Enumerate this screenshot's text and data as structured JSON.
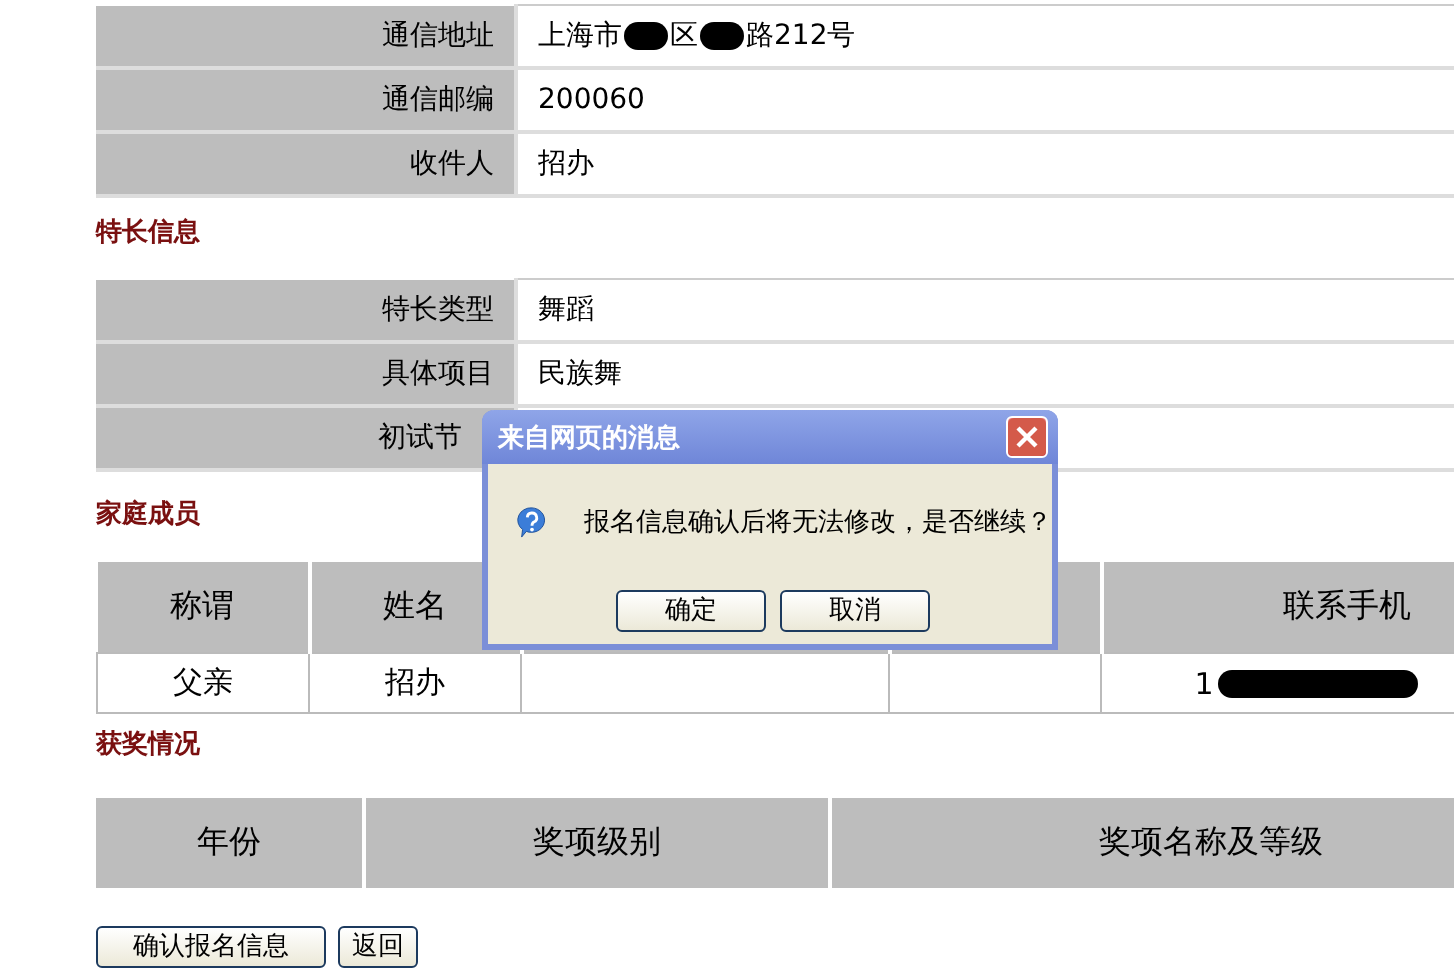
{
  "contact": {
    "rows": [
      {
        "label": "通信地址",
        "parts": [
          {
            "kind": "text",
            "text": "上海市"
          },
          {
            "kind": "redacted"
          },
          {
            "kind": "text",
            "text": "区"
          },
          {
            "kind": "redacted"
          },
          {
            "kind": "text",
            "text": "路212号"
          }
        ]
      },
      {
        "label": "通信邮编",
        "parts": [
          {
            "kind": "text",
            "text": "200060"
          }
        ]
      },
      {
        "label": "收件人",
        "parts": [
          {
            "kind": "text",
            "text": "招办"
          }
        ]
      }
    ]
  },
  "specialty": {
    "title": "特长信息",
    "rows": [
      {
        "label": "特长类型",
        "parts": [
          {
            "kind": "text",
            "text": "舞蹈"
          }
        ]
      },
      {
        "label": "具体项目",
        "parts": [
          {
            "kind": "text",
            "text": "民族舞"
          }
        ]
      },
      {
        "label": "初试节"
      }
    ]
  },
  "family": {
    "title": "家庭成员",
    "columns": [
      {
        "label": "称谓"
      },
      {
        "label": "姓名"
      },
      {},
      {},
      {
        "label": "联系手机"
      }
    ],
    "rows": [
      {
        "cells": [
          {
            "parts": [
              {
                "kind": "text",
                "text": "父亲"
              }
            ]
          },
          {
            "parts": [
              {
                "kind": "text",
                "text": "招办"
              }
            ]
          },
          {},
          {},
          {
            "parts": [
              {
                "kind": "text",
                "text": "1"
              },
              {
                "kind": "redacted"
              }
            ]
          }
        ]
      }
    ]
  },
  "awards": {
    "title": "获奖情况",
    "columns": [
      {
        "label": "年份"
      },
      {
        "label": "奖项级别"
      },
      {
        "label": "奖项名称及等级"
      }
    ]
  },
  "buttons": [
    "确认报名信息",
    "返回"
  ],
  "dialog": {
    "title": "来自网页的消息",
    "message": "报名信息确认后将无法修改，是否继续？",
    "buttons": [
      "确定",
      "取消"
    ]
  }
}
